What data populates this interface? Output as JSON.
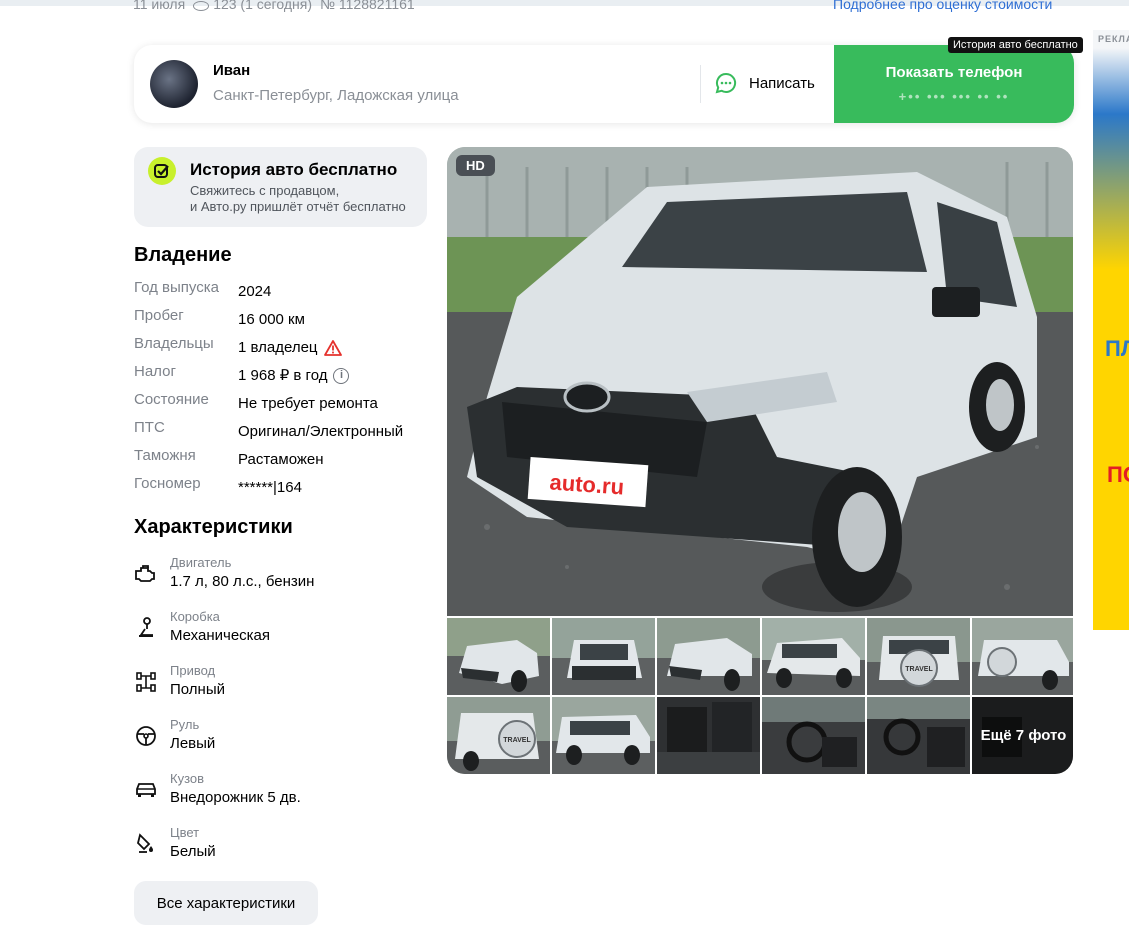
{
  "top": {
    "meta": {
      "date": "11 июля",
      "views": "123 (1 сегодня)",
      "number": "№ 1128821161"
    },
    "link": "Подробнее про оценку стоимости"
  },
  "seller": {
    "name": "Иван",
    "location": "Санкт-Петербург, Ладожская улица",
    "chat_label": "Написать",
    "phone_label": "Показать телефон",
    "phone_mask": "+•• ••• ••• •• ••"
  },
  "tooltip": "История авто бесплатно",
  "history": {
    "title": "История авто бесплатно",
    "subtitle_line1": "Свяжитесь с продавцом,",
    "subtitle_line2": "и Авто.ру пришлёт отчёт бесплатно"
  },
  "ownership": {
    "title": "Владение",
    "rows": [
      {
        "key": "Год выпуска",
        "value": "2024"
      },
      {
        "key": "Пробег",
        "value": "16 000 км"
      },
      {
        "key": "Владельцы",
        "value": "1 владелец"
      },
      {
        "key": "Налог",
        "value": "1 968 ₽ в год"
      },
      {
        "key": "Состояние",
        "value": "Не требует ремонта"
      },
      {
        "key": "ПТС",
        "value": "Оригинал/Электронный"
      },
      {
        "key": "Таможня",
        "value": "Растаможен"
      },
      {
        "key": "Госномер",
        "value": "******|164"
      }
    ]
  },
  "specs": {
    "title": "Характеристики",
    "rows": [
      {
        "key": "Двигатель",
        "value": "1.7 л, 80 л.с., бензин",
        "icon": "engine-icon"
      },
      {
        "key": "Коробка",
        "value": "Механическая",
        "icon": "gearbox-icon"
      },
      {
        "key": "Привод",
        "value": "Полный",
        "icon": "drivetrain-icon"
      },
      {
        "key": "Руль",
        "value": "Левый",
        "icon": "steering-wheel-icon"
      },
      {
        "key": "Кузов",
        "value": "Внедорожник 5 дв.",
        "icon": "car-body-icon"
      },
      {
        "key": "Цвет",
        "value": "Белый",
        "icon": "color-palette-icon"
      }
    ],
    "all_button": "Все характеристики"
  },
  "gallery": {
    "hd_badge": "HD",
    "plate_text": "auto.ru",
    "more_photos": "Ещё 7 фото",
    "spare_wheel_text": "TRAVEL"
  },
  "ad": {
    "label": "РЕКЛАМА",
    "text1": "ПЛ",
    "text2": "ПО"
  },
  "colors": {
    "accent_green": "#38bb5c",
    "history_icon": "#c8f02c",
    "warning": "#e5322d",
    "link": "#2f6fd4"
  }
}
